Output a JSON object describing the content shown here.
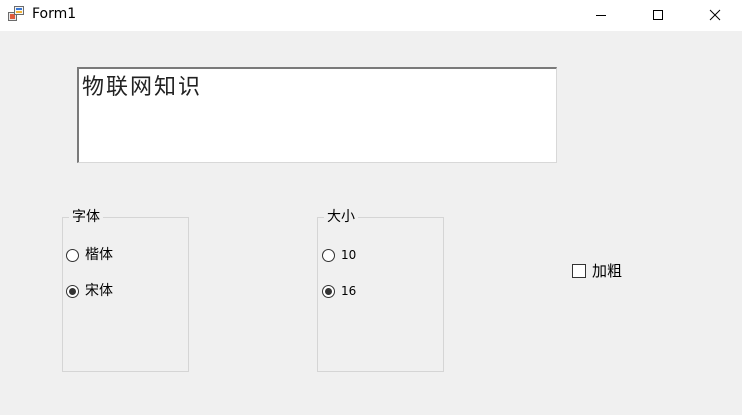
{
  "window": {
    "title": "Form1",
    "app_icon": "form-app-icon",
    "controls": {
      "minimize_icon": "minimize-icon",
      "maximize_icon": "maximize-icon",
      "close_icon": "close-icon"
    }
  },
  "textbox": {
    "value": "物联网知识"
  },
  "font_group": {
    "legend": "字体",
    "options": [
      {
        "label": "楷体",
        "checked": false
      },
      {
        "label": "宋体",
        "checked": true
      }
    ]
  },
  "size_group": {
    "legend": "大小",
    "options": [
      {
        "label": "10",
        "checked": false
      },
      {
        "label": "16",
        "checked": true
      }
    ]
  },
  "bold_checkbox": {
    "label": "加粗",
    "checked": false
  },
  "colors": {
    "client_bg": "#f0f0f0",
    "titlebar_bg": "#ffffff",
    "group_border": "#d5d5d5"
  }
}
